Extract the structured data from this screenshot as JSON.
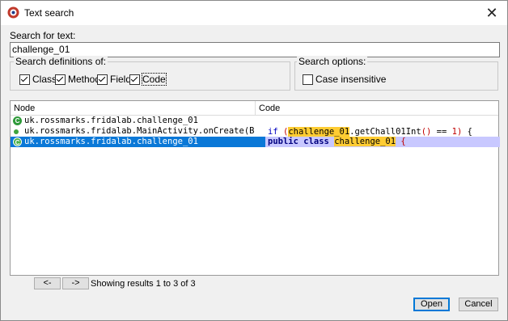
{
  "window": {
    "title": "Text search",
    "close": "✕"
  },
  "search": {
    "label": "Search for text:",
    "value": "challenge_01"
  },
  "definitions": {
    "legend": "Search definitions of:",
    "items": [
      {
        "label": "Class",
        "checked": true
      },
      {
        "label": "Method",
        "checked": true
      },
      {
        "label": "Field",
        "checked": true
      },
      {
        "label": "Code",
        "checked": true
      }
    ]
  },
  "options": {
    "legend": "Search options:",
    "items": [
      {
        "label": "Case insensitive",
        "checked": false
      }
    ]
  },
  "results": {
    "columns": {
      "node": "Node",
      "code": "Code"
    },
    "rows": [
      {
        "icon": "class-icon",
        "node": "uk.rossmarks.fridalab.challenge_01",
        "code": ""
      },
      {
        "icon": "method-icon",
        "node": "uk.rossmarks.fridalab.MainActivity.onCreate(Bund...",
        "code_parts": {
          "kw": "if",
          "p1": " (",
          "hl": "challenge_01",
          "mid": ".getChall01Int",
          "p2": "()",
          "eq": " == ",
          "num": "1",
          "p3": ")",
          "end": " {"
        }
      },
      {
        "icon": "class-icon",
        "node": "uk.rossmarks.fridalab.challenge_01",
        "code_parts": {
          "kw1": "public",
          "kw2": "class",
          "hl": "challenge_01",
          "end": "{"
        }
      }
    ]
  },
  "pager": {
    "prev": "<-",
    "next": "->",
    "status": "Showing results 1 to 3 of 3"
  },
  "buttons": {
    "open": "Open",
    "cancel": "Cancel"
  }
}
